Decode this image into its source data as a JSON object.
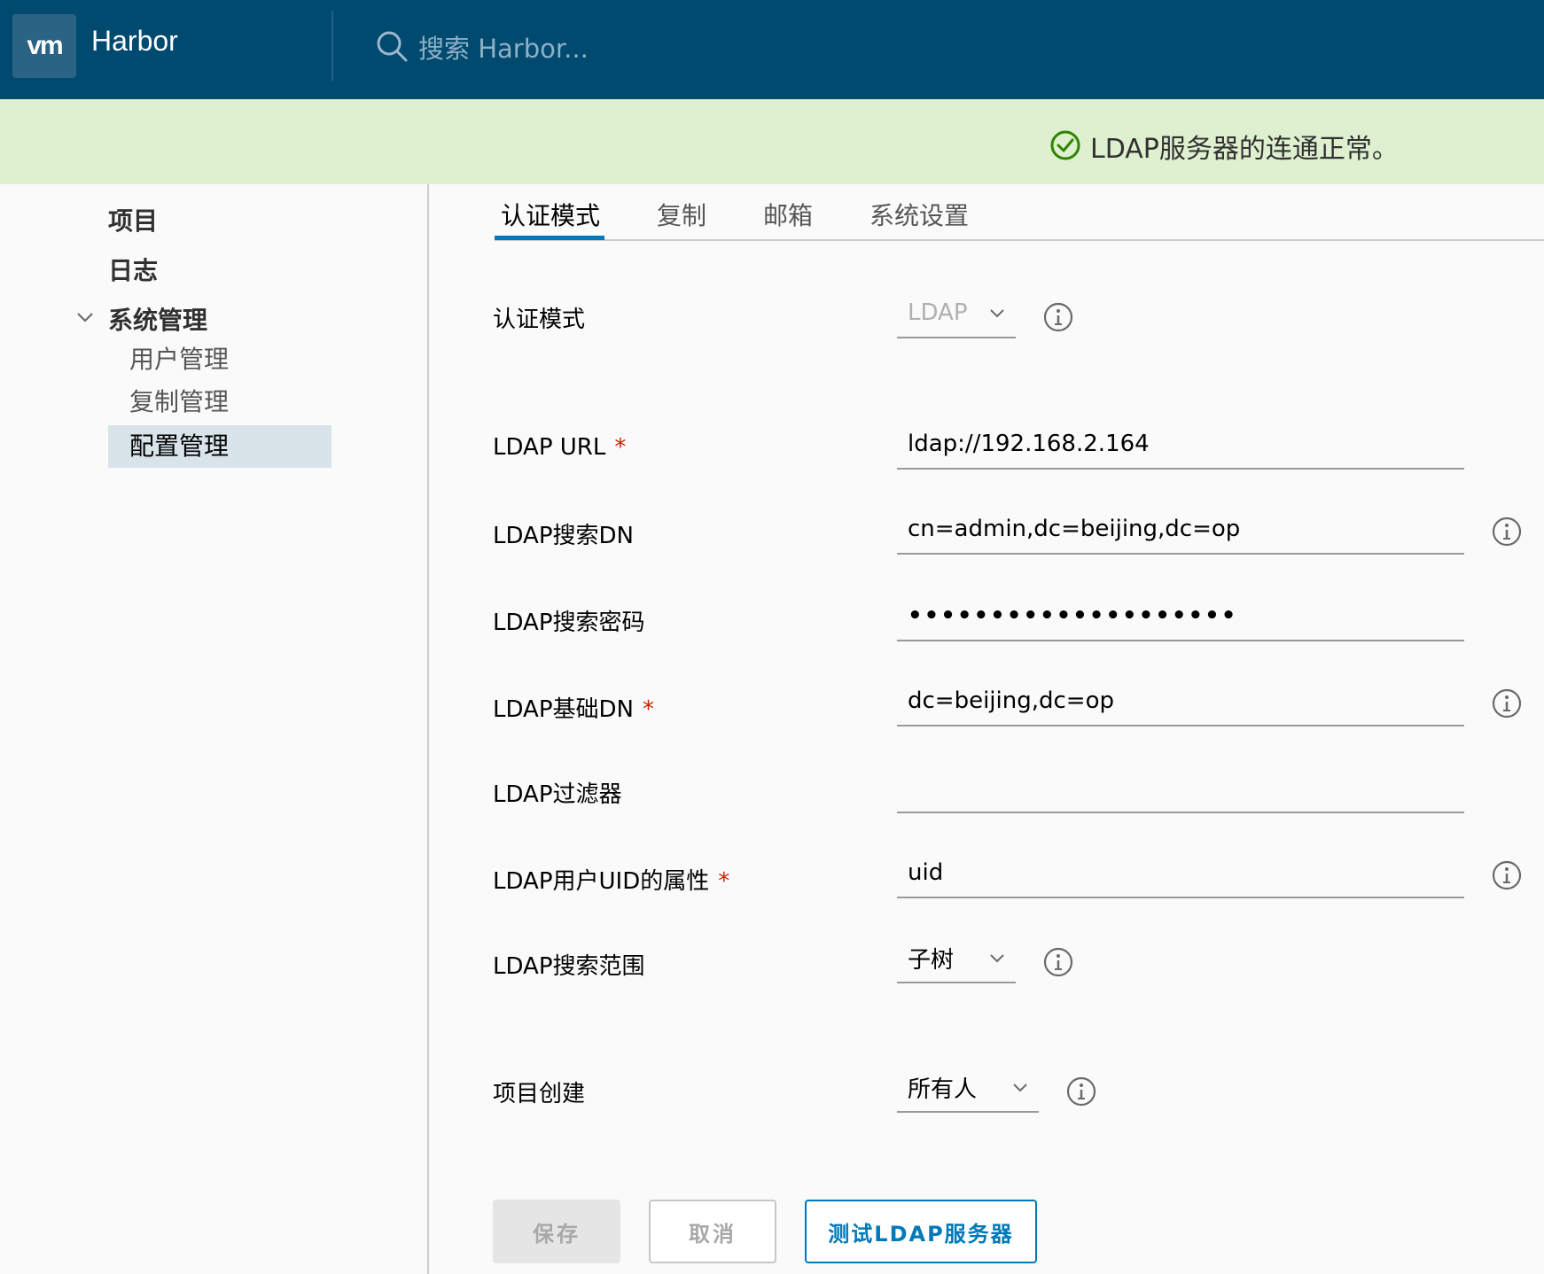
{
  "header": {
    "logo_text": "vm",
    "app_title": "Harbor",
    "search_placeholder": "搜索 Harbor..."
  },
  "alert": {
    "message": "LDAP服务器的连通正常。"
  },
  "sidebar": {
    "items": [
      {
        "label": "项目"
      },
      {
        "label": "日志"
      },
      {
        "label": "系统管理"
      }
    ],
    "sub_items": [
      {
        "label": "用户管理"
      },
      {
        "label": "复制管理"
      },
      {
        "label": "配置管理",
        "active": true
      }
    ]
  },
  "tabs": [
    {
      "label": "认证模式",
      "active": true
    },
    {
      "label": "复制"
    },
    {
      "label": "邮箱"
    },
    {
      "label": "系统设置"
    }
  ],
  "form": {
    "auth_mode": {
      "label": "认证模式",
      "value": "LDAP"
    },
    "ldap_url": {
      "label": "LDAP URL",
      "required": "*",
      "value": "ldap://192.168.2.164"
    },
    "search_dn": {
      "label": "LDAP搜索DN",
      "value": "cn=admin,dc=beijing,dc=op"
    },
    "search_password": {
      "label": "LDAP搜索密码",
      "value": "••••••••••••••••••••"
    },
    "base_dn": {
      "label": "LDAP基础DN",
      "required": "*",
      "value": "dc=beijing,dc=op"
    },
    "filter": {
      "label": "LDAP过滤器",
      "value": ""
    },
    "uid": {
      "label": "LDAP用户UID的属性",
      "required": "*",
      "value": "uid"
    },
    "scope": {
      "label": "LDAP搜索范围",
      "value": "子树"
    },
    "project_creation": {
      "label": "项目创建",
      "value": "所有人"
    }
  },
  "buttons": {
    "save": "保存",
    "cancel": "取消",
    "test": "测试LDAP服务器"
  },
  "colors": {
    "header_bg": "#004a70",
    "alert_bg": "#dff0d0",
    "accent": "#0079b8",
    "required": "#c92100"
  }
}
